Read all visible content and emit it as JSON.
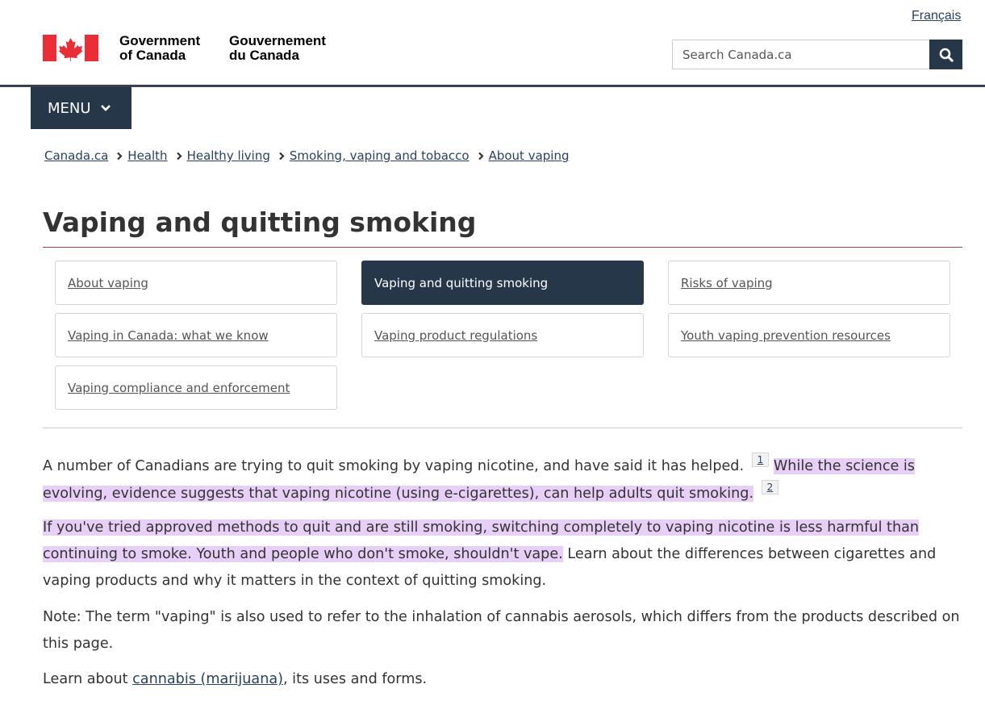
{
  "header": {
    "language_link": "Français",
    "wordmark_en_line1": "Government",
    "wordmark_en_line2": "of Canada",
    "wordmark_fr_line1": "Gouvernement",
    "wordmark_fr_line2": "du Canada",
    "search_placeholder": "Search Canada.ca",
    "menu_label": "MENU",
    "colors": {
      "navy": "#26374a",
      "flag_red": "#eb2d37",
      "link": "#284162"
    }
  },
  "breadcrumb": [
    "Canada.ca",
    "Health",
    "Healthy living",
    "Smoking, vaping and tobacco",
    "About vaping"
  ],
  "page_title": "Vaping and quitting smoking",
  "subnav": [
    {
      "label": "About vaping",
      "active": false
    },
    {
      "label": "Vaping and quitting smoking",
      "active": true
    },
    {
      "label": "Risks of vaping",
      "active": false
    },
    {
      "label": "Vaping in Canada: what we know",
      "active": false
    },
    {
      "label": "Vaping product regulations",
      "active": false
    },
    {
      "label": "Youth vaping prevention resources",
      "active": false
    },
    {
      "label": "Vaping compliance and enforcement",
      "active": false
    }
  ],
  "content": {
    "p1_text": "A number of Canadians are trying to quit smoking by vaping nicotine, and have said it has helped.",
    "p1_fn1": "1",
    "p1_highlight": "While the science is evolving, evidence suggests that vaping nicotine (using e-cigarettes), can help adults quit smoking.",
    "p1_fn2": "2",
    "p2_highlight": "If you've tried approved methods to quit and are still smoking, switching completely to vaping nicotine is less harmful than continuing to smoke. Youth and people who don't smoke, shouldn't vape.",
    "p2_text": "Learn about the differences between cigarettes and vaping products and why it matters in the context of quitting smoking.",
    "p3_text": "Note: The term \"vaping\" is also used to refer to the inhalation of cannabis aerosols, which differs from the products described on this page.",
    "p4_prefix": "Learn about",
    "p4_link": "cannabis (marijuana)",
    "p4_suffix": ", its uses and forms."
  }
}
